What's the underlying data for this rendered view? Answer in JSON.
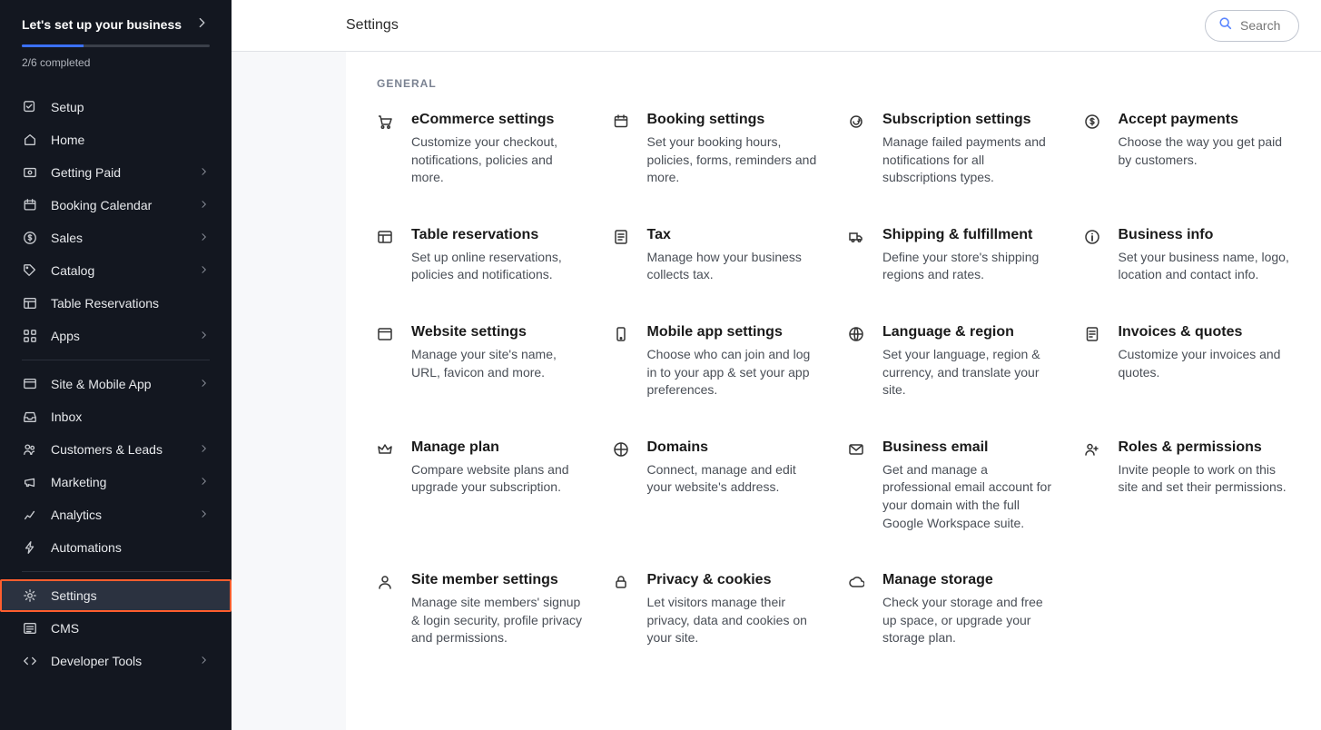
{
  "setup": {
    "title": "Let's set up your business",
    "progress_text": "2/6 completed"
  },
  "nav_group1": [
    {
      "label": "Setup",
      "sub": false,
      "icon": "setup"
    },
    {
      "label": "Home",
      "sub": false,
      "icon": "home"
    },
    {
      "label": "Getting Paid",
      "sub": true,
      "icon": "paid"
    },
    {
      "label": "Booking Calendar",
      "sub": true,
      "icon": "calendar"
    },
    {
      "label": "Sales",
      "sub": true,
      "icon": "dollar"
    },
    {
      "label": "Catalog",
      "sub": true,
      "icon": "tag"
    },
    {
      "label": "Table Reservations",
      "sub": false,
      "icon": "table"
    },
    {
      "label": "Apps",
      "sub": true,
      "icon": "apps"
    }
  ],
  "nav_group2": [
    {
      "label": "Site & Mobile App",
      "sub": true,
      "icon": "site"
    },
    {
      "label": "Inbox",
      "sub": false,
      "icon": "inbox"
    },
    {
      "label": "Customers & Leads",
      "sub": true,
      "icon": "customers"
    },
    {
      "label": "Marketing",
      "sub": true,
      "icon": "marketing"
    },
    {
      "label": "Analytics",
      "sub": true,
      "icon": "analytics"
    },
    {
      "label": "Automations",
      "sub": false,
      "icon": "automations"
    }
  ],
  "nav_group3": [
    {
      "label": "Settings",
      "sub": false,
      "icon": "settings",
      "active": true
    },
    {
      "label": "CMS",
      "sub": false,
      "icon": "cms"
    },
    {
      "label": "Developer Tools",
      "sub": true,
      "icon": "dev"
    }
  ],
  "topbar": {
    "title": "Settings"
  },
  "search": {
    "placeholder": "Search"
  },
  "section_label": "GENERAL",
  "cards": [
    {
      "icon": "cart",
      "title": "eCommerce settings",
      "desc": "Customize your checkout, notifications, policies and more."
    },
    {
      "icon": "calendar",
      "title": "Booking settings",
      "desc": "Set your booking hours, policies, forms, reminders and more."
    },
    {
      "icon": "subscription",
      "title": "Subscription settings",
      "desc": "Manage failed payments and notifications for all subscriptions types."
    },
    {
      "icon": "dollar",
      "title": "Accept payments",
      "desc": "Choose the way you get paid by customers."
    },
    {
      "icon": "table",
      "title": "Table reservations",
      "desc": "Set up online reservations, policies and notifications."
    },
    {
      "icon": "tax",
      "title": "Tax",
      "desc": "Manage how your business collects tax."
    },
    {
      "icon": "truck",
      "title": "Shipping & fulfillment",
      "desc": "Define your store's shipping regions and rates."
    },
    {
      "icon": "info",
      "title": "Business info",
      "desc": "Set your business name, logo, location and contact info."
    },
    {
      "icon": "window",
      "title": "Website settings",
      "desc": "Manage your site's name, URL, favicon and more."
    },
    {
      "icon": "mobile",
      "title": "Mobile app settings",
      "desc": "Choose who can join and log in to your app & set your app preferences."
    },
    {
      "icon": "globe",
      "title": "Language & region",
      "desc": "Set your language, region & currency, and translate your site."
    },
    {
      "icon": "invoice",
      "title": "Invoices & quotes",
      "desc": "Customize your invoices and quotes."
    },
    {
      "icon": "crown",
      "title": "Manage plan",
      "desc": "Compare website plans and upgrade your subscription."
    },
    {
      "icon": "globe2",
      "title": "Domains",
      "desc": "Connect, manage and edit your website's address."
    },
    {
      "icon": "mail",
      "title": "Business email",
      "desc": "Get and manage a professional email account for your domain with the full Google Workspace suite."
    },
    {
      "icon": "roles",
      "title": "Roles & permissions",
      "desc": "Invite people to work on this site and set their permissions."
    },
    {
      "icon": "member",
      "title": "Site member settings",
      "desc": "Manage site members' signup & login security, profile privacy and permissions."
    },
    {
      "icon": "lock",
      "title": "Privacy & cookies",
      "desc": "Let visitors manage their privacy, data and cookies on your site."
    },
    {
      "icon": "cloud",
      "title": "Manage storage",
      "desc": "Check your storage and free up space, or upgrade your storage plan."
    }
  ]
}
